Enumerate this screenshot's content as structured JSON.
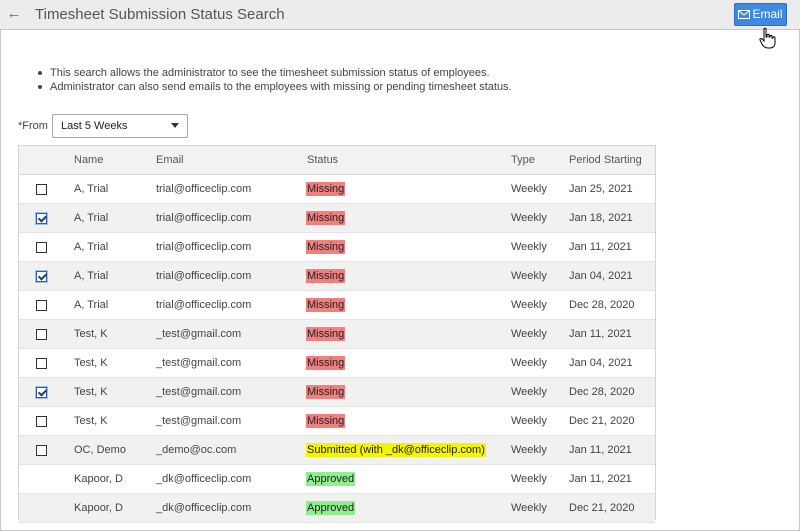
{
  "header": {
    "back_icon": "left-arrow-icon",
    "title": "Timesheet Submission Status Search",
    "email_button": "Email",
    "email_icon": "envelope-icon"
  },
  "info": [
    "This search allows the administrator to see the timesheet submission status of employees.",
    "Administrator can also send emails to the employees with missing or pending timesheet status."
  ],
  "filter": {
    "label": "*From",
    "selected": "Last 5 Weeks"
  },
  "table": {
    "columns": [
      "Name",
      "Email",
      "Status",
      "Type",
      "Period Starting"
    ],
    "rows": [
      {
        "checkbox": "unchecked",
        "name": "A, Trial",
        "email": "trial@officeclip.com",
        "status": "Missing",
        "type": "Weekly",
        "period": "Jan 25, 2021"
      },
      {
        "checkbox": "checked",
        "name": "A, Trial",
        "email": "trial@officeclip.com",
        "status": "Missing",
        "type": "Weekly",
        "period": "Jan 18, 2021"
      },
      {
        "checkbox": "unchecked",
        "name": "A, Trial",
        "email": "trial@officeclip.com",
        "status": "Missing",
        "type": "Weekly",
        "period": "Jan 11, 2021"
      },
      {
        "checkbox": "checked",
        "name": "A, Trial",
        "email": "trial@officeclip.com",
        "status": "Missing",
        "type": "Weekly",
        "period": "Jan 04, 2021"
      },
      {
        "checkbox": "unchecked",
        "name": "A, Trial",
        "email": "trial@officeclip.com",
        "status": "Missing",
        "type": "Weekly",
        "period": "Dec 28, 2020"
      },
      {
        "checkbox": "unchecked",
        "name": "Test, K",
        "email": "_test@gmail.com",
        "status": "Missing",
        "type": "Weekly",
        "period": "Jan 11, 2021"
      },
      {
        "checkbox": "unchecked",
        "name": "Test, K",
        "email": "_test@gmail.com",
        "status": "Missing",
        "type": "Weekly",
        "period": "Jan 04, 2021"
      },
      {
        "checkbox": "checked",
        "name": "Test, K",
        "email": "_test@gmail.com",
        "status": "Missing",
        "type": "Weekly",
        "period": "Dec 28, 2020"
      },
      {
        "checkbox": "unchecked",
        "name": "Test, K",
        "email": "_test@gmail.com",
        "status": "Missing",
        "type": "Weekly",
        "period": "Dec 21, 2020"
      },
      {
        "checkbox": "unchecked",
        "name": "OC, Demo",
        "email": "_demo@oc.com",
        "status": "Submitted (with _dk@officeclip.com)",
        "type": "Weekly",
        "period": "Jan 11, 2021"
      },
      {
        "checkbox": "none",
        "name": "Kapoor, D",
        "email": "_dk@officeclip.com",
        "status": "Approved",
        "type": "Weekly",
        "period": "Jan 11, 2021"
      },
      {
        "checkbox": "none",
        "name": "Kapoor, D",
        "email": "_dk@officeclip.com",
        "status": "Approved",
        "type": "Weekly",
        "period": "Dec 21, 2020"
      }
    ]
  },
  "colors": {
    "missing": "#f08080",
    "submitted": "#f5f500",
    "approved": "#90ee90",
    "accent": "#3d8ae0"
  }
}
